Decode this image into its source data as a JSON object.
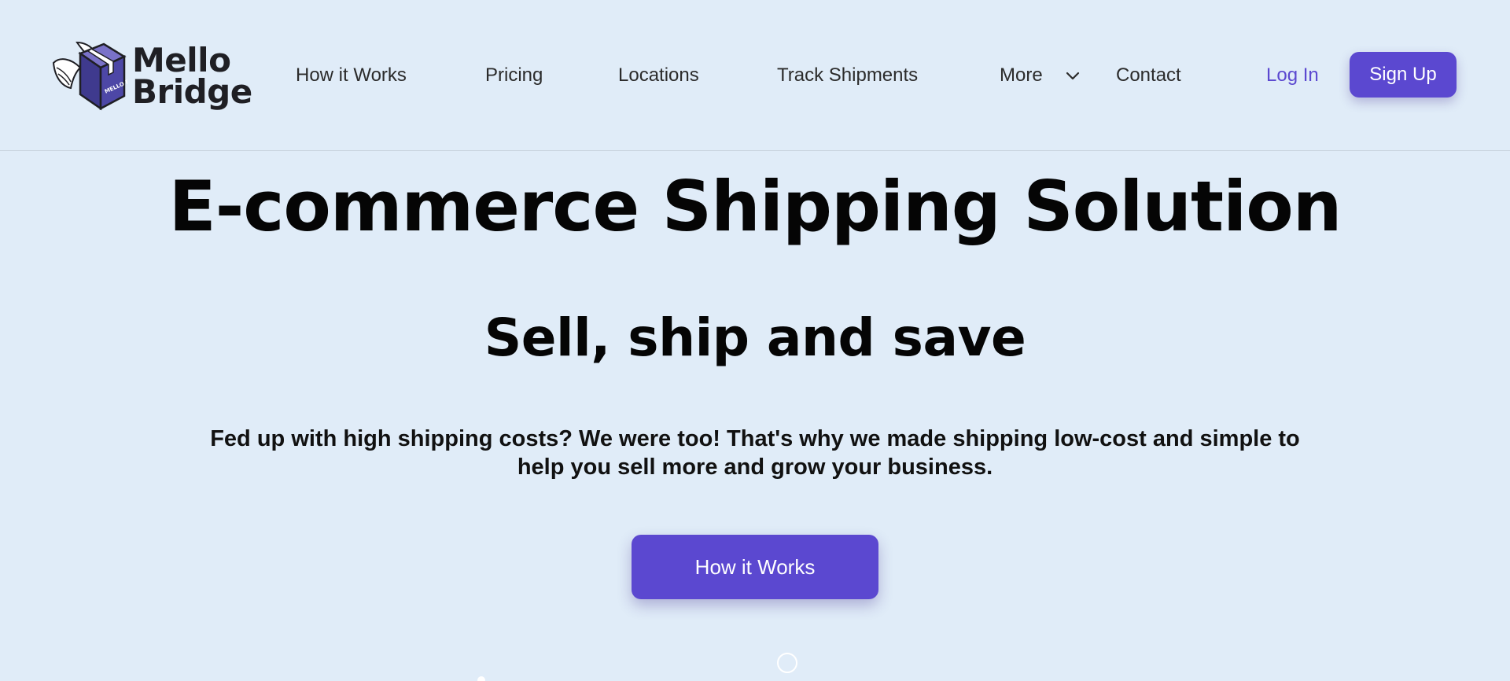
{
  "brand": {
    "name_line1": "Mello",
    "name_line2": "Bridge",
    "box_text": "MELLO BRIDGE",
    "accent": "#5b48d0"
  },
  "nav": {
    "items": [
      {
        "label": "How it Works"
      },
      {
        "label": "Pricing"
      },
      {
        "label": "Locations"
      },
      {
        "label": "Track Shipments"
      },
      {
        "label": "More"
      },
      {
        "label": "Contact"
      }
    ],
    "more_icon": "chevron-down-icon",
    "login_label": "Log In",
    "signup_label": "Sign Up"
  },
  "hero": {
    "title": "E-commerce Shipping Solution",
    "subtitle": "Sell, ship and save",
    "description": "Fed up with high shipping costs? We were too! That's why we made shipping low-cost and simple to help you sell more and grow your business.",
    "cta_label": "How it Works"
  },
  "colors": {
    "background": "#e0ecf8",
    "button": "#5b48d0",
    "login_text": "#5b48d0"
  }
}
